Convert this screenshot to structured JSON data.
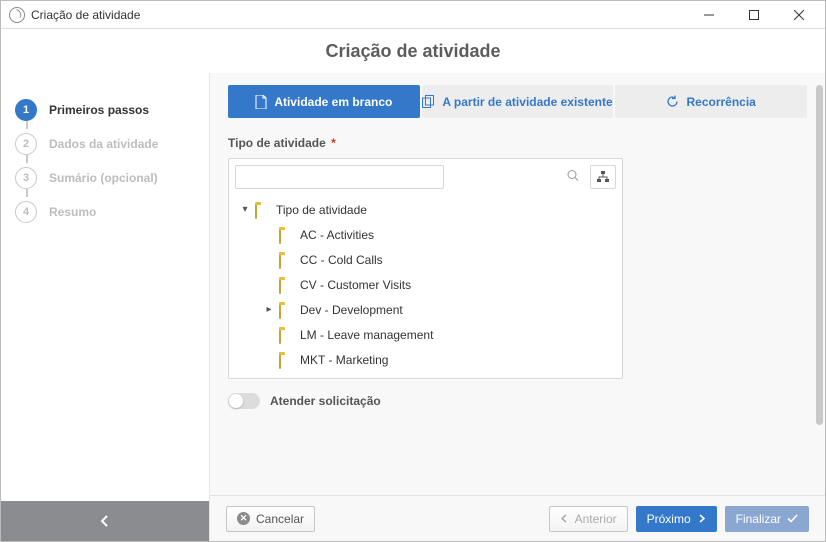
{
  "window": {
    "title": "Criação de atividade"
  },
  "header": {
    "title": "Criação de atividade"
  },
  "sidebar": {
    "steps": [
      {
        "num": "1",
        "label": "Primeiros passos",
        "active": true
      },
      {
        "num": "2",
        "label": "Dados da atividade",
        "active": false
      },
      {
        "num": "3",
        "label": "Sumário (opcional)",
        "active": false
      },
      {
        "num": "4",
        "label": "Resumo",
        "active": false
      }
    ]
  },
  "tabs": [
    {
      "label": "Atividade em branco",
      "active": true
    },
    {
      "label": "A partir de atividade existente",
      "active": false
    },
    {
      "label": "Recorrência",
      "active": false
    }
  ],
  "field": {
    "label": "Tipo de atividade",
    "required": "*"
  },
  "tree": {
    "root": {
      "label": "Tipo de atividade",
      "expanded": true
    },
    "children": [
      {
        "label": "AC - Activities",
        "hasChildren": false
      },
      {
        "label": "CC - Cold Calls",
        "hasChildren": false
      },
      {
        "label": "CV - Customer Visits",
        "hasChildren": false
      },
      {
        "label": "Dev - Development",
        "hasChildren": true
      },
      {
        "label": "LM - Leave management",
        "hasChildren": false
      },
      {
        "label": "MKT - Marketing",
        "hasChildren": false
      }
    ]
  },
  "toggle": {
    "label": "Atender solicitação",
    "on": false
  },
  "footer": {
    "cancel": "Cancelar",
    "prev": "Anterior",
    "next": "Próximo",
    "finish": "Finalizar"
  }
}
